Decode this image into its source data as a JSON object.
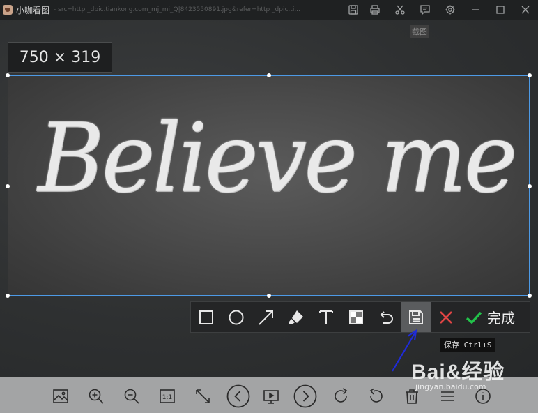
{
  "window": {
    "app_name": "小咖看图",
    "url_fragment": " - src=http _dpic.tiankong.com_mj_mi_Q|8423550891.jpg&refer=http _dpic.ti..."
  },
  "title_tools": {
    "items": [
      "save-icon",
      "print-icon",
      "scissors-icon",
      "comment-icon",
      "gear-icon",
      "minimize-icon",
      "maximize-icon",
      "close-icon"
    ],
    "screenshot_tooltip": "截图"
  },
  "selection": {
    "size_label": "750 × 319",
    "image_text": "Believe me",
    "border_color": "#4d9ae6"
  },
  "annotation_toolbar": {
    "tools": [
      "rectangle-icon",
      "ellipse-icon",
      "arrow-icon",
      "marker-icon",
      "text-icon",
      "mosaic-icon",
      "undo-icon",
      "save-icon",
      "cancel-icon"
    ],
    "active_tool": "save-icon",
    "done_label": "完成",
    "save_tooltip": "保存 Ctrl+S",
    "cancel_color": "#e04545",
    "done_color": "#22c24a"
  },
  "viewer_bar": {
    "buttons": [
      "image-icon",
      "zoom-in-icon",
      "zoom-out-icon",
      "actual-size-icon",
      "fit-screen-icon",
      "previous-icon",
      "slideshow-icon",
      "next-icon",
      "rotate-right-icon",
      "rotate-left-icon",
      "delete-icon",
      "menu-icon",
      "info-icon"
    ],
    "actual_size_label": "1:1"
  },
  "watermark": {
    "main": "Bai&经验",
    "sub": "jingyan.baidu.com"
  },
  "annotation_arrow_color": "#1f2bd8"
}
